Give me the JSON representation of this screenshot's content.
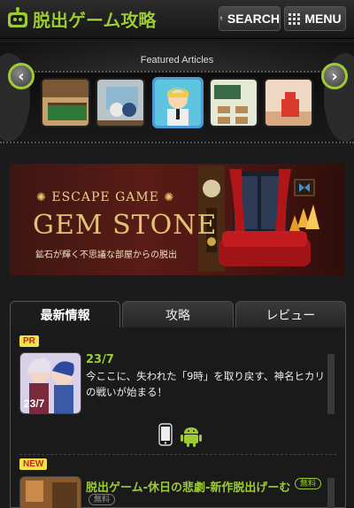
{
  "header": {
    "logo_text": "脱出ゲーム攻略",
    "search_label": "SEARCH",
    "menu_label": "MENU"
  },
  "featured": {
    "title": "Featured Articles"
  },
  "banner": {
    "title": "ESCAPE GAME",
    "main": "GEM STONE",
    "subtitle": "鉱石が輝く不思議な部屋からの脱出"
  },
  "tabs": [
    {
      "label": "最新情報"
    },
    {
      "label": "攻略"
    },
    {
      "label": "レビュー"
    }
  ],
  "items": [
    {
      "badge": "PR",
      "title": "23/7",
      "description": "今ここに、失われた「9時」を取り戻す、神名ヒカリの戦いが始まる！",
      "thumb_text": "23/7"
    },
    {
      "badge": "NEW",
      "title": "脱出ゲーム-休日の悲劇-新作脱出げーむ",
      "free_label": "無料",
      "free_label_2": "無料"
    }
  ],
  "colors": {
    "accent": "#9ccc32",
    "badge_bg": "#f1e24a",
    "badge_text": "#cc2222"
  }
}
